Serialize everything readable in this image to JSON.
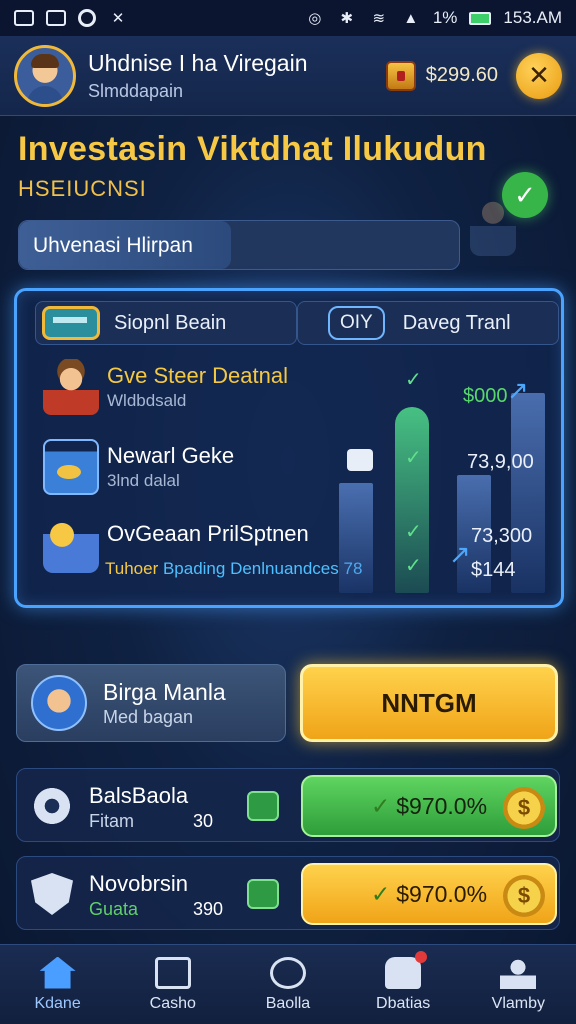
{
  "status_bar": {
    "time": "153.AM",
    "battery": "1%"
  },
  "header": {
    "player_name": "Uhdnise I ha Viregain",
    "player_sub": "Slmddapain",
    "balance": "$299.60"
  },
  "hero": {
    "title": "Investasin Viktdhat Ilukudun",
    "subtitle": "HSEIUCNSI",
    "search_text": "Uhvenasi Hlirpan"
  },
  "panel": {
    "tab_left": "Siopnl Beain",
    "tab_right_pill": "OIY",
    "tab_right": "Daveg Tranl",
    "rows": [
      {
        "title": "Gve Steer Deatnal",
        "sub": "Wldbdsald"
      },
      {
        "title": "Newarl Geke",
        "sub": "3lnd dalal"
      },
      {
        "title": "OvGeaan PrilSptnen",
        "sub": ""
      }
    ],
    "note_prefix": "Tuhoer",
    "note_text": " Bpading Denlnuandces 78",
    "values": [
      "$000",
      "73,9,00",
      "73,300",
      "$144"
    ]
  },
  "featured": {
    "name": "Birga Manla",
    "sub": "Med bagan",
    "cta": "NNTGM"
  },
  "list": [
    {
      "name": "BalsBaola",
      "sub": "Fitam",
      "num": "30",
      "button": "$970.0%"
    },
    {
      "name": "Novobrsin",
      "sub": "Guata",
      "num": "390",
      "button": "$970.0%"
    }
  ],
  "nav": [
    "Kdane",
    "Casho",
    "Baolla",
    "Dbatias",
    "Vlamby"
  ]
}
